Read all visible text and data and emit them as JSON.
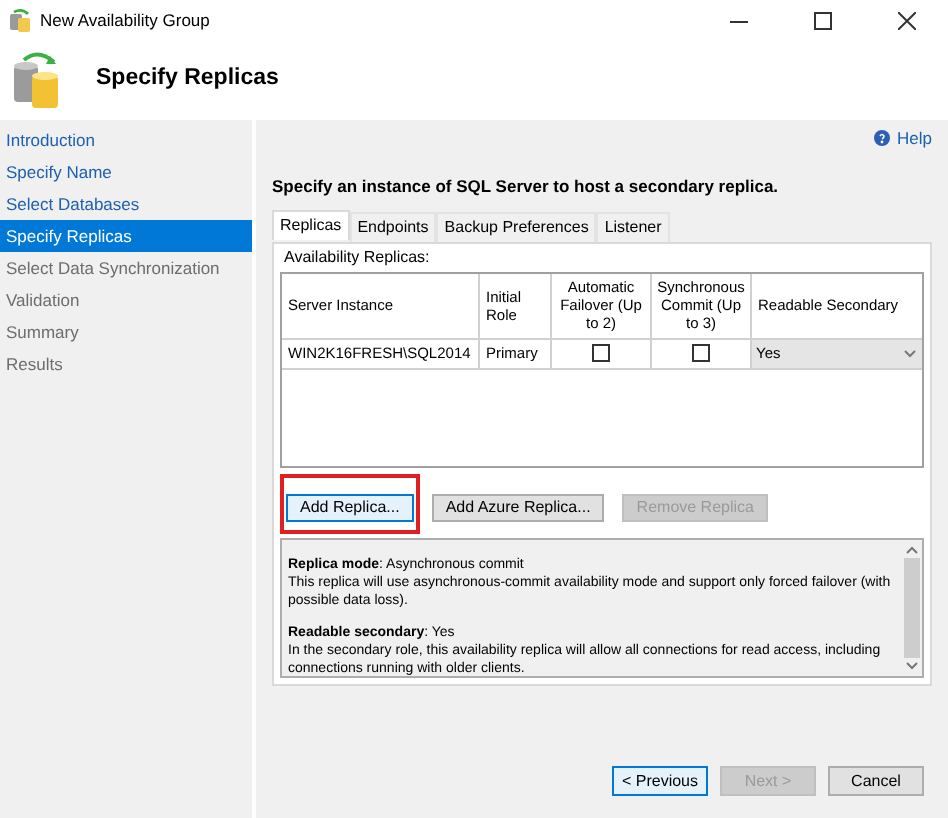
{
  "window": {
    "title": "New Availability Group"
  },
  "header": {
    "title": "Specify Replicas"
  },
  "sidebar": {
    "items": [
      {
        "label": "Introduction",
        "selected": false,
        "disabled": false
      },
      {
        "label": "Specify Name",
        "selected": false,
        "disabled": false
      },
      {
        "label": "Select Databases",
        "selected": false,
        "disabled": false
      },
      {
        "label": "Specify Replicas",
        "selected": true,
        "disabled": false
      },
      {
        "label": "Select Data Synchronization",
        "selected": false,
        "disabled": true
      },
      {
        "label": "Validation",
        "selected": false,
        "disabled": true
      },
      {
        "label": "Summary",
        "selected": false,
        "disabled": true
      },
      {
        "label": "Results",
        "selected": false,
        "disabled": true
      }
    ]
  },
  "help": "Help",
  "instruction": "Specify an instance of SQL Server to host a secondary replica.",
  "tabs": [
    {
      "label": "Replicas",
      "selected": true
    },
    {
      "label": "Endpoints",
      "selected": false
    },
    {
      "label": "Backup Preferences",
      "selected": false
    },
    {
      "label": "Listener",
      "selected": false
    }
  ],
  "group_label": "Availability Replicas:",
  "table": {
    "columns": [
      "Server Instance",
      "Initial Role",
      "Automatic Failover (Up to 2)",
      "Synchronous Commit (Up to 3)",
      "Readable Secondary"
    ],
    "rows": [
      {
        "server": "WIN2K16FRESH\\SQL2014",
        "role": "Primary",
        "automatic_failover": false,
        "synchronous_commit": false,
        "readable_secondary": "Yes"
      }
    ]
  },
  "replica_buttons": [
    {
      "label": "Add Replica...",
      "disabled": false,
      "highlighted": true
    },
    {
      "label": "Add Azure Replica...",
      "disabled": false,
      "highlighted": false
    },
    {
      "label": "Remove Replica",
      "disabled": true,
      "highlighted": false
    }
  ],
  "description": [
    "**Replica mode**: Asynchronous commit",
    "This replica will use asynchronous-commit availability mode and support only forced failover (with possible data loss).",
    "**Readable secondary**: Yes",
    "In the secondary role, this availability replica will allow all connections for read access, including connections running with older clients."
  ],
  "footer_buttons": [
    {
      "label": "< Previous",
      "disabled": false
    },
    {
      "label": "Next >",
      "disabled": true
    },
    {
      "label": "Cancel",
      "disabled": false
    }
  ]
}
